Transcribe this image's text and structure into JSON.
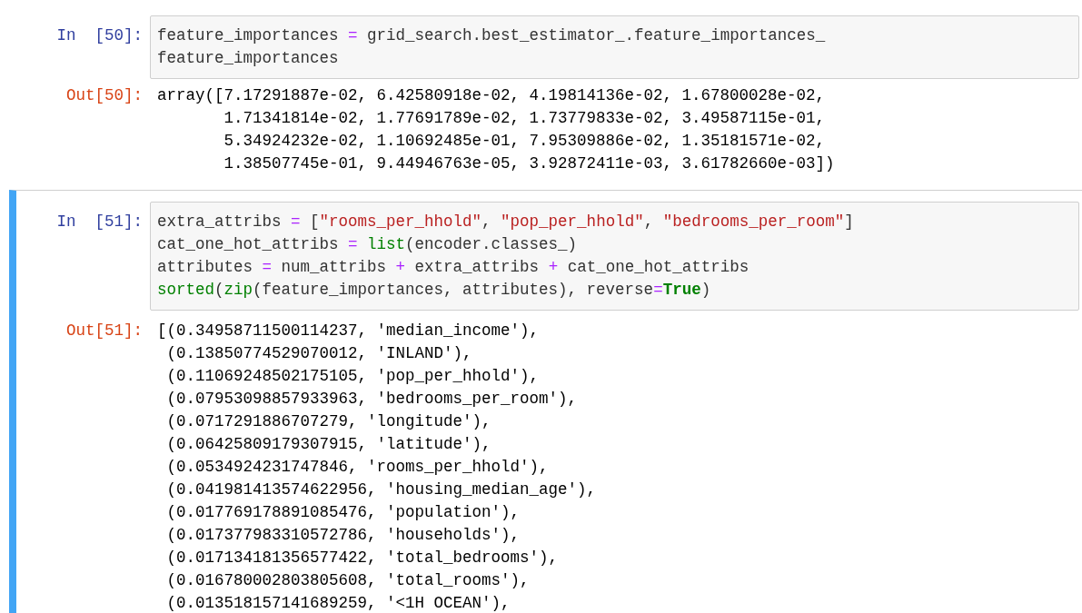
{
  "cells": [
    {
      "selected": false,
      "input": {
        "prompt": "In  [50]:",
        "lines": [
          [
            {
              "kind": "name",
              "text": "feature_importances "
            },
            {
              "kind": "op",
              "text": "="
            },
            {
              "kind": "name",
              "text": " grid_search.best_estimator_.feature_importances_"
            }
          ],
          [
            {
              "kind": "name",
              "text": "feature_importances"
            }
          ]
        ]
      },
      "output": {
        "prompt": "Out[50]:",
        "lines": [
          "array([7.17291887e-02, 6.42580918e-02, 4.19814136e-02, 1.67800028e-02,",
          "       1.71341814e-02, 1.77691789e-02, 1.73779833e-02, 3.49587115e-01,",
          "       5.34924232e-02, 1.10692485e-01, 7.95309886e-02, 1.35181571e-02,",
          "       1.38507745e-01, 9.44946763e-05, 3.92872411e-03, 3.61782660e-03])"
        ]
      }
    },
    {
      "selected": true,
      "input": {
        "prompt": "In  [51]:",
        "lines": [
          [
            {
              "kind": "name",
              "text": "extra_attribs "
            },
            {
              "kind": "op",
              "text": "="
            },
            {
              "kind": "name",
              "text": " ["
            },
            {
              "kind": "string",
              "text": "\"rooms_per_hhold\""
            },
            {
              "kind": "name",
              "text": ", "
            },
            {
              "kind": "string",
              "text": "\"pop_per_hhold\""
            },
            {
              "kind": "name",
              "text": ", "
            },
            {
              "kind": "string",
              "text": "\"bedrooms_per_room\""
            },
            {
              "kind": "name",
              "text": "]"
            }
          ],
          [
            {
              "kind": "name",
              "text": "cat_one_hot_attribs "
            },
            {
              "kind": "op",
              "text": "= "
            },
            {
              "kind": "builtin",
              "text": "list"
            },
            {
              "kind": "name",
              "text": "(encoder.classes_)"
            }
          ],
          [
            {
              "kind": "name",
              "text": "attributes "
            },
            {
              "kind": "op",
              "text": "="
            },
            {
              "kind": "name",
              "text": " num_attribs "
            },
            {
              "kind": "op",
              "text": "+"
            },
            {
              "kind": "name",
              "text": " extra_attribs "
            },
            {
              "kind": "op",
              "text": "+"
            },
            {
              "kind": "name",
              "text": " cat_one_hot_attribs"
            }
          ],
          [
            {
              "kind": "builtin",
              "text": "sorted"
            },
            {
              "kind": "name",
              "text": "("
            },
            {
              "kind": "builtin",
              "text": "zip"
            },
            {
              "kind": "name",
              "text": "(feature_importances, attributes), reverse"
            },
            {
              "kind": "op",
              "text": "="
            },
            {
              "kind": "keyword",
              "text": "True"
            },
            {
              "kind": "name",
              "text": ")"
            }
          ]
        ]
      },
      "output": {
        "prompt": "Out[51]:",
        "lines": [
          "[(0.34958711500114237, 'median_income'),",
          " (0.13850774529070012, 'INLAND'),",
          " (0.11069248502175105, 'pop_per_hhold'),",
          " (0.07953098857933963, 'bedrooms_per_room'),",
          " (0.0717291886707279, 'longitude'),",
          " (0.06425809179307915, 'latitude'),",
          " (0.0534924231747846, 'rooms_per_hhold'),",
          " (0.041981413574622956, 'housing_median_age'),",
          " (0.017769178891085476, 'population'),",
          " (0.017377983310572786, 'households'),",
          " (0.017134181356577422, 'total_bedrooms'),",
          " (0.016780002803805608, 'total_rooms'),",
          " (0.013518157141689259, '<1H OCEAN'),"
        ]
      }
    }
  ]
}
